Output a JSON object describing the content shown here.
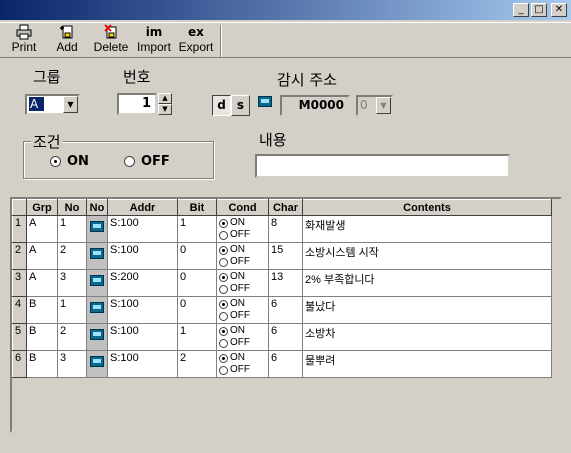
{
  "window": {
    "min_label": "_",
    "max_label": "□",
    "close_label": "✕"
  },
  "toolbar": {
    "print": {
      "icon": "printer-icon",
      "label": "Print"
    },
    "add": {
      "icon": "add-document-icon",
      "label": "Add"
    },
    "delete": {
      "icon": "delete-document-icon",
      "label": "Delete"
    },
    "import": {
      "glyph": "im",
      "label": "Import"
    },
    "export": {
      "glyph": "ex",
      "label": "Export"
    }
  },
  "form": {
    "group_label": "그룹",
    "group_value": "A",
    "number_label": "번호",
    "number_value": "1",
    "watch_addr_label": "감시 주소",
    "d_label": "d",
    "s_label": "s",
    "addr_value": "M0000",
    "addr_sub_value": "0",
    "condition_label": "조건",
    "cond_on": "ON",
    "cond_off": "OFF",
    "cond_selected": "ON",
    "content_label": "내용",
    "content_value": ""
  },
  "grid": {
    "columns": [
      "Grp",
      "No",
      "No",
      "Addr",
      "Bit",
      "Cond",
      "Char",
      "Contents"
    ],
    "cond_on": "ON",
    "cond_off": "OFF",
    "rows": [
      {
        "idx": "1",
        "grp": "A",
        "no": "1",
        "addr": "S:100",
        "bit": "1",
        "cond": "ON",
        "char": "8",
        "contents": "화재발생"
      },
      {
        "idx": "2",
        "grp": "A",
        "no": "2",
        "addr": "S:100",
        "bit": "0",
        "cond": "ON",
        "char": "15",
        "contents": "소방시스템 시작"
      },
      {
        "idx": "3",
        "grp": "A",
        "no": "3",
        "addr": "S:200",
        "bit": "0",
        "cond": "ON",
        "char": "13",
        "contents": "2% 부족합니다"
      },
      {
        "idx": "4",
        "grp": "B",
        "no": "1",
        "addr": "S:100",
        "bit": "0",
        "cond": "ON",
        "char": "6",
        "contents": "불났다"
      },
      {
        "idx": "5",
        "grp": "B",
        "no": "2",
        "addr": "S:100",
        "bit": "1",
        "cond": "ON",
        "char": "6",
        "contents": "소방차"
      },
      {
        "idx": "6",
        "grp": "B",
        "no": "3",
        "addr": "S:100",
        "bit": "2",
        "cond": "ON",
        "char": "6",
        "contents": "물뿌려"
      }
    ]
  }
}
